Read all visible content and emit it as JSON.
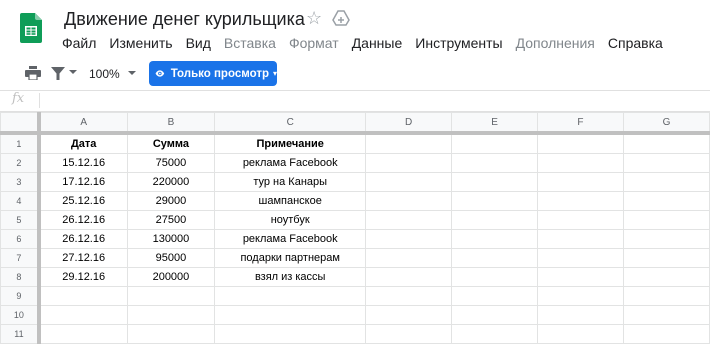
{
  "doc": {
    "title": "Движение денег курильщика",
    "star_icon": "star-outline-icon",
    "drive_icon": "move-to-drive-icon"
  },
  "menu": [
    {
      "label": "Файл",
      "disabled": false
    },
    {
      "label": "Изменить",
      "disabled": false
    },
    {
      "label": "Вид",
      "disabled": false
    },
    {
      "label": "Вставка",
      "disabled": true
    },
    {
      "label": "Формат",
      "disabled": true
    },
    {
      "label": "Данные",
      "disabled": false
    },
    {
      "label": "Инструменты",
      "disabled": false
    },
    {
      "label": "Дополнения",
      "disabled": true
    },
    {
      "label": "Справка",
      "disabled": false
    }
  ],
  "toolbar": {
    "zoom": "100%",
    "view_button_label": "Только просмотр",
    "accent_color": "#1a73e8"
  },
  "formula_bar": {
    "fx_label": "fx",
    "value": ""
  },
  "sheet": {
    "columns": [
      "A",
      "B",
      "C",
      "D",
      "E",
      "F",
      "G"
    ],
    "row_numbers": [
      "1",
      "2",
      "3",
      "4",
      "5",
      "6",
      "7",
      "8",
      "9",
      "10",
      "11"
    ],
    "rows": [
      [
        "Дата",
        "Сумма",
        "Примечание",
        "",
        "",
        "",
        ""
      ],
      [
        "15.12.16",
        "75000",
        "реклама Facebook",
        "",
        "",
        "",
        ""
      ],
      [
        "17.12.16",
        "220000",
        "тур на Канары",
        "",
        "",
        "",
        ""
      ],
      [
        "25.12.16",
        "29000",
        "шампанское",
        "",
        "",
        "",
        ""
      ],
      [
        "26.12.16",
        "27500",
        "ноутбук",
        "",
        "",
        "",
        ""
      ],
      [
        "26.12.16",
        "130000",
        "реклама Facebook",
        "",
        "",
        "",
        ""
      ],
      [
        "27.12.16",
        "95000",
        "подарки партнерам",
        "",
        "",
        "",
        ""
      ],
      [
        "29.12.16",
        "200000",
        "взял из кассы",
        "",
        "",
        "",
        ""
      ],
      [
        "",
        "",
        "",
        "",
        "",
        "",
        ""
      ],
      [
        "",
        "",
        "",
        "",
        "",
        "",
        ""
      ],
      [
        "",
        "",
        "",
        "",
        "",
        "",
        ""
      ]
    ]
  }
}
